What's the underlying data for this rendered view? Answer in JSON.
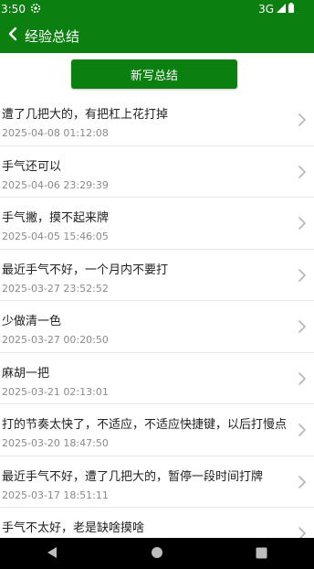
{
  "status_bar": {
    "time": "3:50",
    "network": "3G",
    "icons": [
      "settings-gear-icon",
      "signal-icon",
      "battery-icon"
    ]
  },
  "app_bar": {
    "title": "经验总结",
    "back_icon": "chevron-left-icon"
  },
  "new_button": {
    "label": "新写总结"
  },
  "entries": [
    {
      "text": "遭了几把大的，有把杠上花打掉",
      "time": "2025-04-08 01:12:08"
    },
    {
      "text": "手气还可以",
      "time": "2025-04-06 23:29:39"
    },
    {
      "text": "手气撇，摸不起来牌",
      "time": "2025-04-05 15:46:05"
    },
    {
      "text": "最近手气不好，一个月内不要打",
      "time": "2025-03-27 23:52:52"
    },
    {
      "text": "少做清一色",
      "time": "2025-03-27 00:20:50"
    },
    {
      "text": "麻胡一把",
      "time": "2025-03-21 02:13:01"
    },
    {
      "text": "打的节奏太快了，不适应，不适应快捷键，以后打慢点",
      "time": "2025-03-20 18:47:50"
    },
    {
      "text": "最近手气不好，遭了几把大的，暂停一段时间打牌",
      "time": "2025-03-17 18:51:11"
    },
    {
      "text": "手气不太好，老是缺啥摸啥",
      "time": ""
    }
  ],
  "colors": {
    "primary": "#0b7f0f",
    "text": "#222222",
    "secondary_text": "#8a8a8a",
    "divider": "#e6e6e6",
    "chevron": "#b5b5b5"
  },
  "nav_bar": {
    "buttons": [
      "back-triangle-icon",
      "home-circle-icon",
      "recents-square-icon"
    ]
  }
}
